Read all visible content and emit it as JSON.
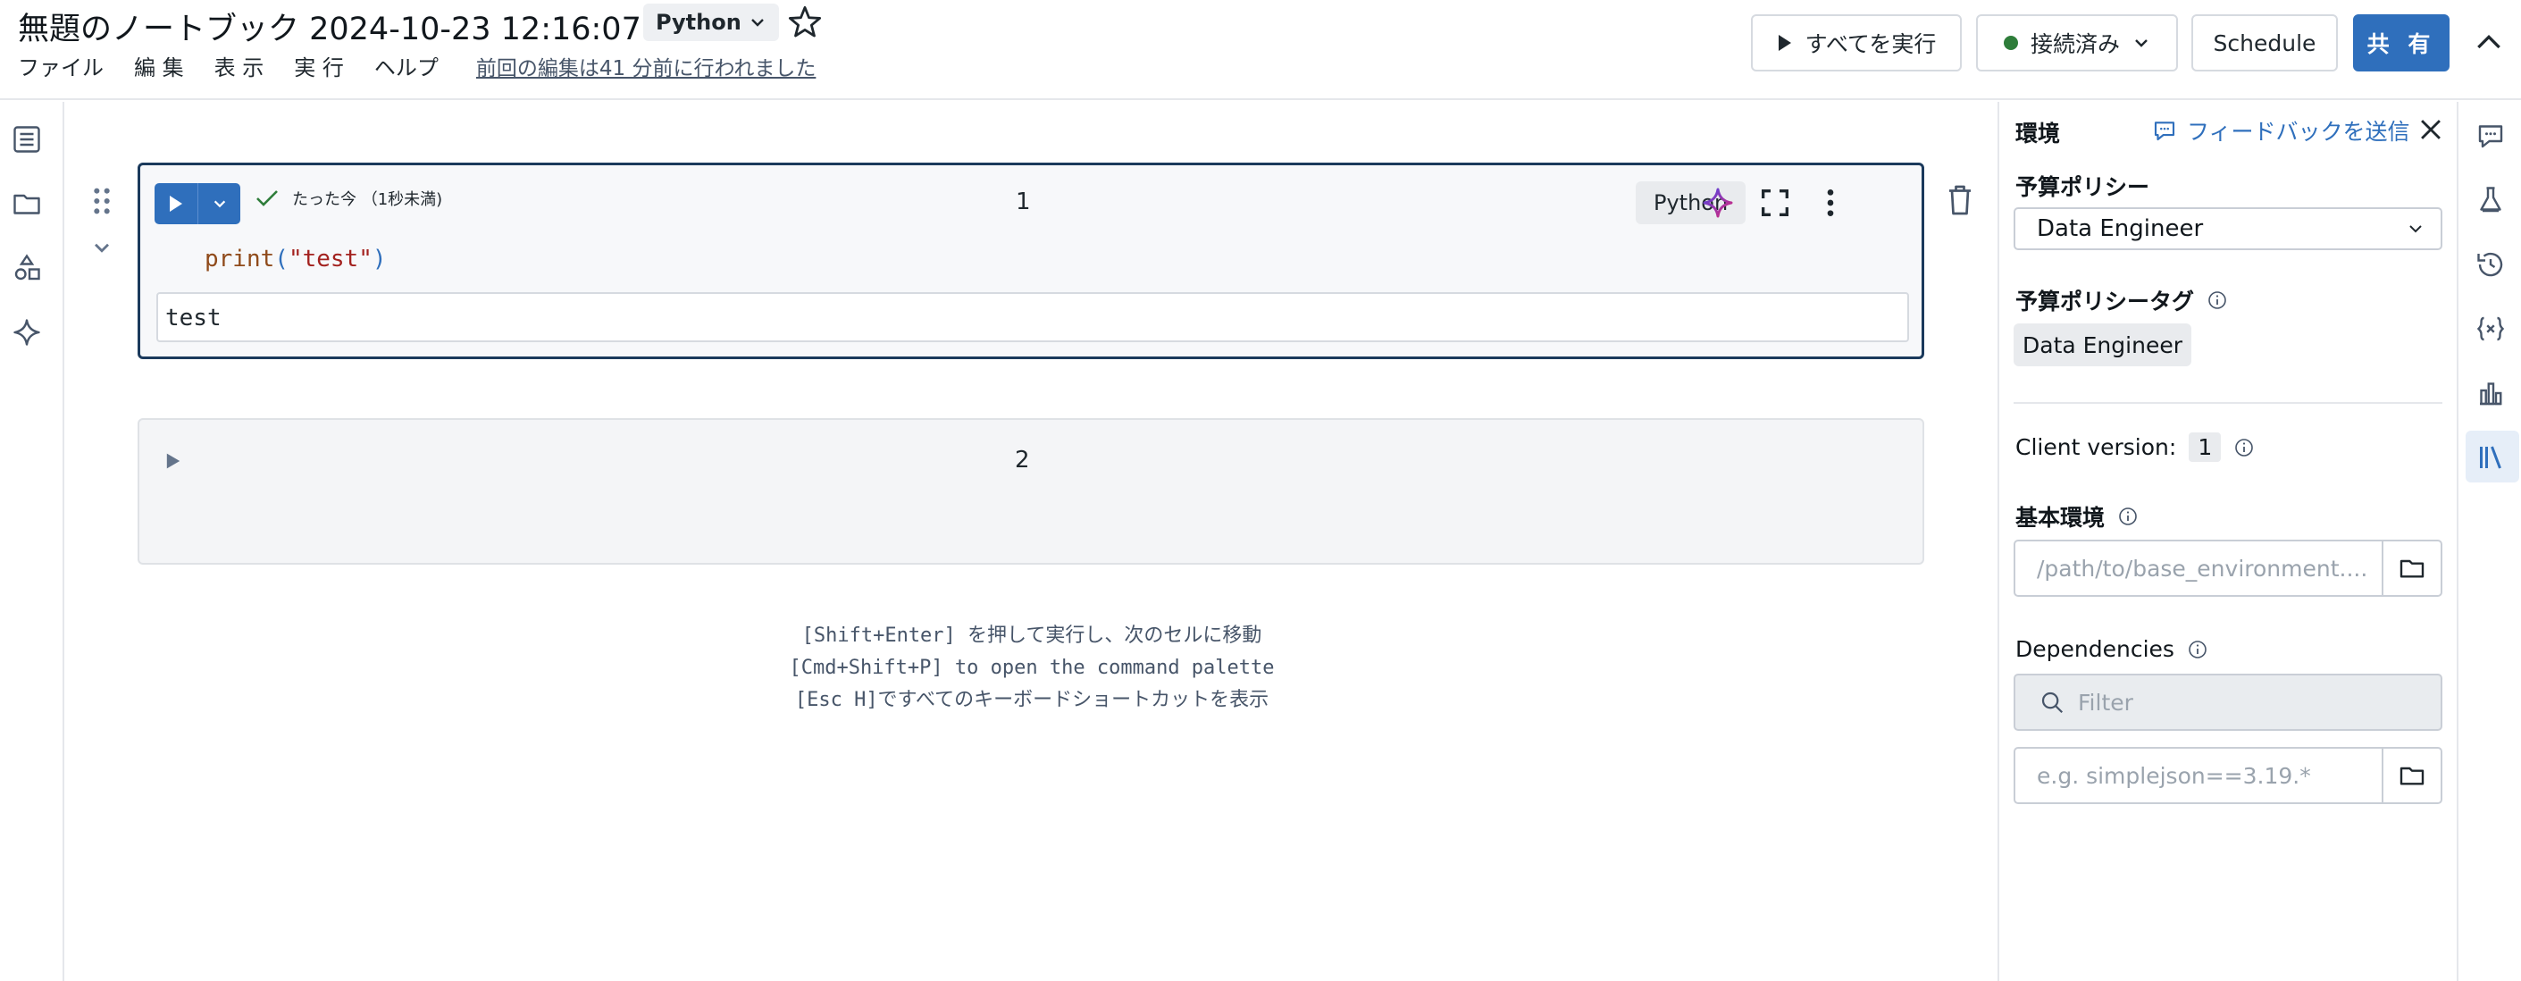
{
  "header": {
    "title": "無題のノートブック 2024-10-23 12:16:07",
    "language": "Python",
    "menus": [
      "ファイル",
      "編 集",
      "表 示",
      "実 行",
      "ヘルプ"
    ],
    "last_edit": "前回の編集は41 分前に行われました",
    "run_all_label": "すべてを実行",
    "connection_label": "接続済み",
    "schedule_label": "Schedule",
    "share_label": "共 有"
  },
  "cells": [
    {
      "number": "1",
      "status": "たった今 （1秒未満)",
      "language": "Python",
      "code": {
        "fn": "print",
        "open": "(",
        "str": "\"test\"",
        "close": ")"
      },
      "output": "test"
    },
    {
      "number": "2"
    }
  ],
  "hints": [
    "[Shift+Enter] を押して実行し、次のセルに移動",
    "[Cmd+Shift+P] to open the command palette",
    "[Esc H]ですべてのキーボードショートカットを表示"
  ],
  "environment_panel": {
    "title": "環境",
    "feedback_link": "フィードバックを送信",
    "budget_policy_label": "予算ポリシー",
    "budget_policy_value": "Data Engineer",
    "budget_tag_label": "予算ポリシータグ",
    "budget_tag_value": "Data Engineer",
    "client_version_label": "Client version:",
    "client_version_value": "1",
    "base_env_label": "基本環境",
    "base_env_placeholder": "/path/to/base_environment....",
    "dependencies_label": "Dependencies",
    "filter_placeholder": "Filter",
    "dependency_placeholder": "e.g. simplejson==3.19.*"
  },
  "colors": {
    "accent": "#2f6fbc",
    "connected": "#2e7d3a",
    "selected_cell_border": "#1b3a5c"
  },
  "icons": {
    "left_rail": [
      "table-of-contents-icon",
      "folder-icon",
      "shapes-icon",
      "assistant-sparkle-icon"
    ],
    "right_rail": [
      "comments-icon",
      "experiments-icon",
      "history-icon",
      "variables-icon",
      "charts-icon",
      "libraries-icon"
    ]
  }
}
